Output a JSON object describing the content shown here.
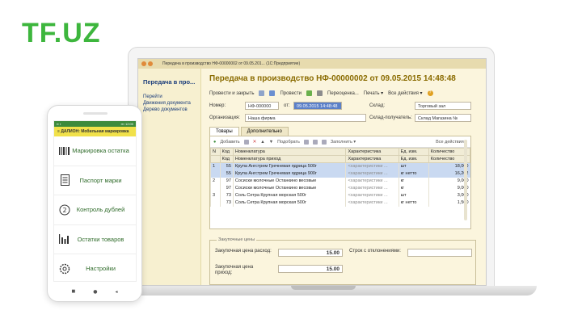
{
  "brand": {
    "logo": "TF.UZ",
    "color": "#3db63d"
  },
  "window": {
    "title": "Передача в производство НФ-00000002 от 09.05.201... (1С:Предприятие)"
  },
  "leftnav": {
    "title": "Передача в про...",
    "items": [
      "Перейти",
      "Движения документа",
      "Дерево документов"
    ]
  },
  "doc": {
    "title": "Передача в производство НФ-00000002 от 09.05.2015 14:48:48",
    "toolbar": {
      "post_close": "Провести и закрыть",
      "post": "Провести",
      "rename": "Переоценка...",
      "print": "Печать",
      "all_actions": "Все действия",
      "help": "?"
    },
    "form": {
      "number_label": "Номер:",
      "number_value": "НФ-000000",
      "from_label": "от:",
      "date_value": "09.05.2015 14:48:48",
      "warehouse_label": "Склад:",
      "warehouse_value": "Торговый зал",
      "org_label": "Организация:",
      "org_value": "Наша фирма",
      "recv_label": "Склад-получатель:",
      "recv_value": "Склад Магазина №"
    },
    "tabs": [
      "Товары",
      "Дополнительно"
    ],
    "table_toolbar": {
      "add": "Добавить",
      "pick": "Подобрать",
      "fill": "Заполнить",
      "all_actions": "Все действия"
    },
    "columns": [
      "N",
      "Код",
      "Номенклатура",
      "Характеристика",
      "Ед. изм.",
      "Количество"
    ],
    "subcolumns": [
      "",
      "Код",
      "Номенклатура приход",
      "Характеристика",
      "Ед. изм.",
      "Количество"
    ],
    "rows": [
      {
        "n": "1",
        "code": "55",
        "name": "Крупа Ангстрем Гречневая ядрица 500г",
        "char": "<характеристики ...",
        "unit": "шт",
        "qty": "18,000",
        "sel": true
      },
      {
        "n": "",
        "code": "55",
        "name": "Крупа Ангстрем Гречневая ядрица 900г",
        "char": "<характеристики ...",
        "unit": "кг нетто",
        "qty": "16,202",
        "sel": true
      },
      {
        "n": "2",
        "code": "97",
        "name": "Сосиски молочные Останкино весовые",
        "char": "<характеристики ...",
        "unit": "кг",
        "qty": "9,000",
        "sel": false
      },
      {
        "n": "",
        "code": "97",
        "name": "Сосиски молочные Останкино весовые",
        "char": "<характеристики ...",
        "unit": "кг",
        "qty": "9,000",
        "sel": false
      },
      {
        "n": "3",
        "code": "73",
        "name": "Соль Сетра Крупная морская 500г",
        "char": "<характеристики ...",
        "unit": "шт",
        "qty": "3,000",
        "sel": false
      },
      {
        "n": "",
        "code": "73",
        "name": "Соль Сетра Крупная морская 500г",
        "char": "<характеристики ...",
        "unit": "кг нетто",
        "qty": "1,500",
        "sel": false
      }
    ],
    "prices": {
      "legend": "Закупочные цены",
      "expense_label": "Закупочная цена расход:",
      "expense_value": "15.00",
      "income_label": "Закупочная цена приход:",
      "income_value": "15.00",
      "deviation_label": "Строк с отклонениями:"
    }
  },
  "phone": {
    "status_left": "▪▪ ▪",
    "status_right": "▪▪▪ 12:00",
    "appbar": "ДАЛИОН: Мобильная маркировка",
    "items": [
      {
        "label": "Маркировка остатка",
        "icon": "barcode-icon"
      },
      {
        "label": "Паспорт марки",
        "icon": "document-icon"
      },
      {
        "label": "Контроль дублей",
        "icon": "number-two-icon"
      },
      {
        "label": "Остатки товаров",
        "icon": "bar-chart-icon"
      },
      {
        "label": "Настройки",
        "icon": "gear-icon"
      }
    ],
    "nav": [
      "■",
      "●",
      "◂"
    ]
  }
}
